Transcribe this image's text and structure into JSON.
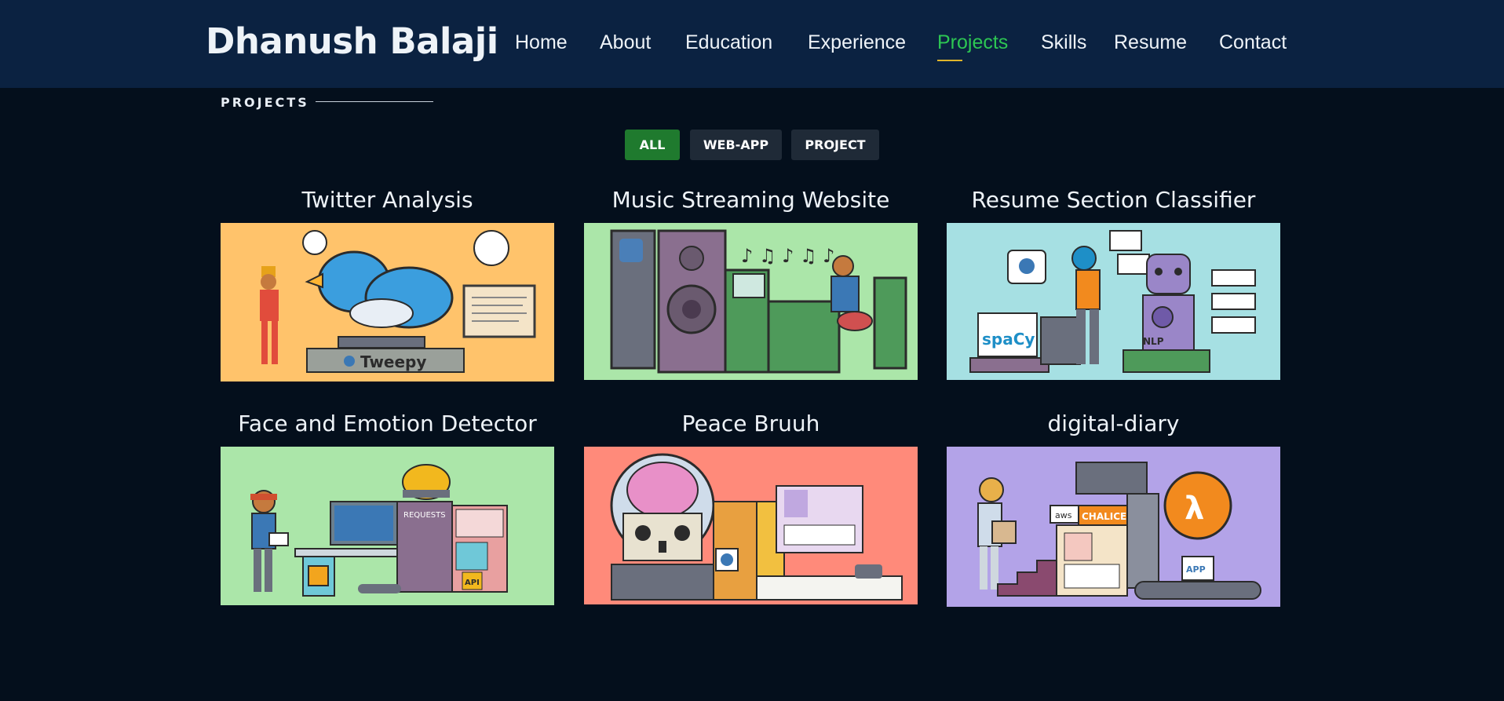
{
  "header": {
    "brand": "Dhanush Balaji",
    "nav": [
      {
        "label": "Home"
      },
      {
        "label": "About"
      },
      {
        "label": "Education"
      },
      {
        "label": "Experience"
      },
      {
        "label": "Projects",
        "active": true
      },
      {
        "label": "Skills"
      },
      {
        "label": "Resume"
      },
      {
        "label": "Contact"
      }
    ]
  },
  "section": {
    "label": "PROJECTS"
  },
  "filters": [
    {
      "label": "ALL",
      "active": true
    },
    {
      "label": "WEB-APP"
    },
    {
      "label": "PROJECT"
    }
  ],
  "projects": [
    {
      "title": "Twitter Analysis",
      "bg": "#ffc36b",
      "thumb_text": "Tweepy"
    },
    {
      "title": "Music Streaming Website",
      "bg": "#abe6a9"
    },
    {
      "title": "Resume Section Classifier",
      "bg": "#a6e0e3",
      "thumb_text": "spaCy",
      "thumb_text2": "NLP"
    },
    {
      "title": "Face and Emotion Detector",
      "bg": "#abe6a9",
      "thumb_text": "REQUESTS",
      "thumb_text2": "API"
    },
    {
      "title": "Peace Bruuh",
      "bg": "#ff8a7a"
    },
    {
      "title": "digital-diary",
      "bg": "#b3a3e8",
      "thumb_text": "CHALICE",
      "thumb_text2": "aws",
      "thumb_text3": "APP"
    }
  ],
  "colors": {
    "accent": "#2dc653",
    "header_bg": "#0b2241",
    "page_bg": "#040f1c",
    "underline": "#e0b52b"
  }
}
